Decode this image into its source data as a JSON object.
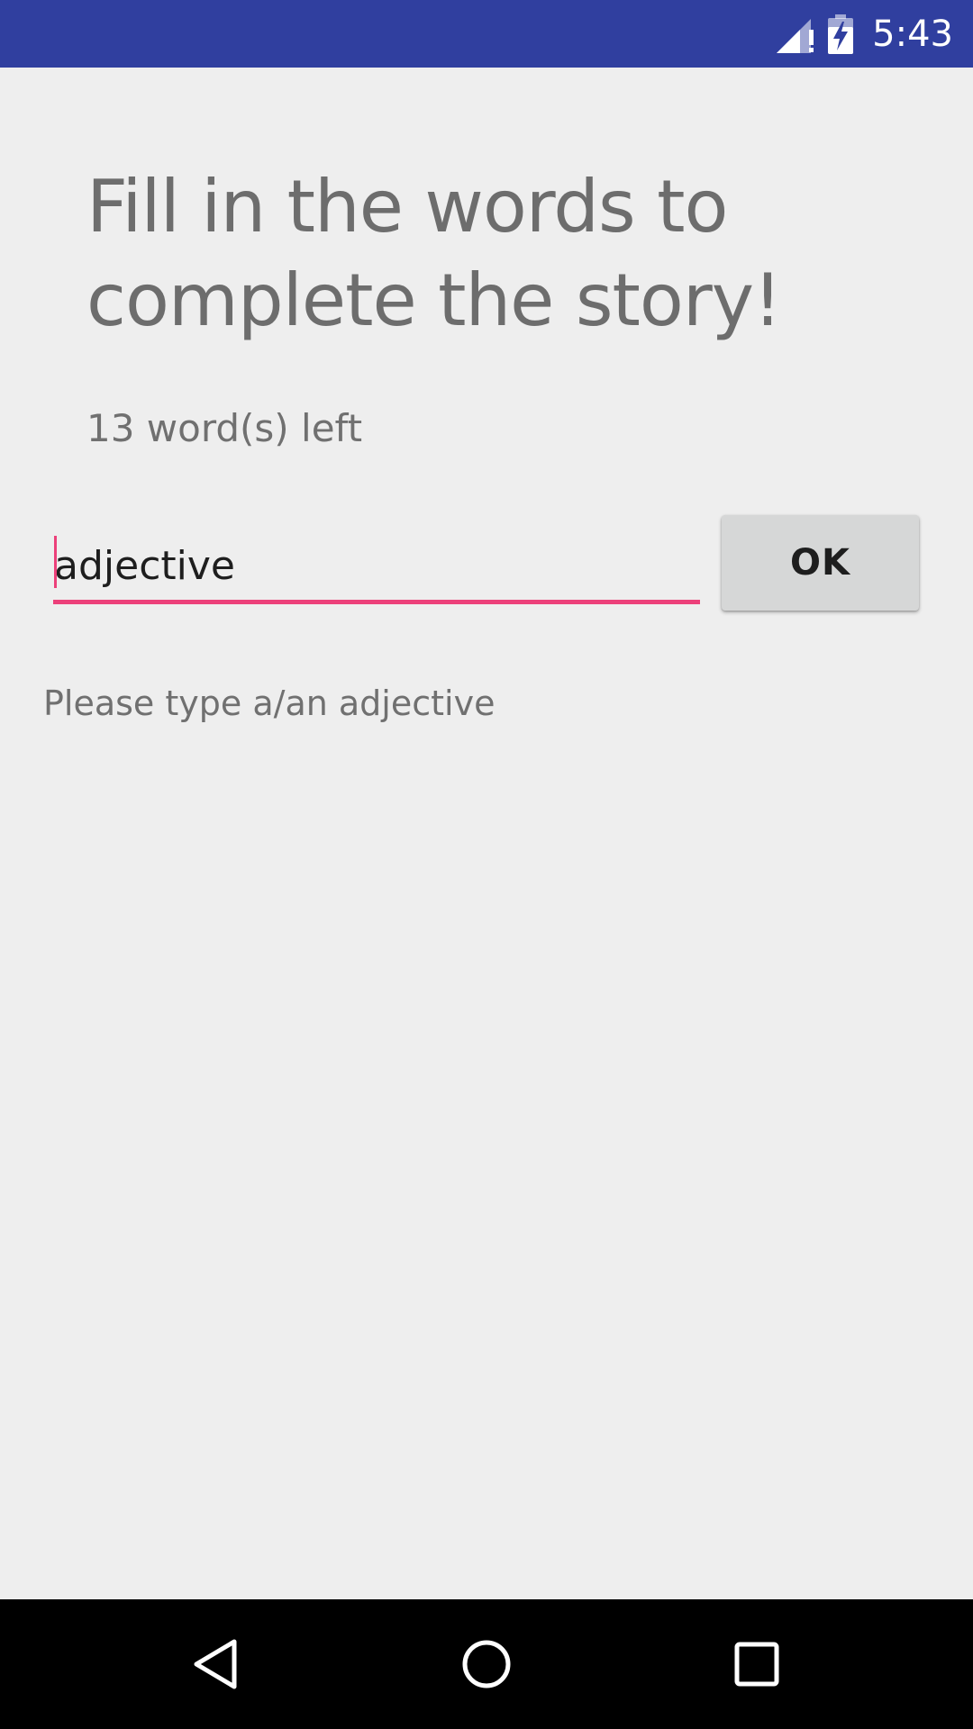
{
  "status_bar": {
    "time": "5:43",
    "background_color": "#303f9f",
    "icons": [
      "signal-alert-icon",
      "battery-charging-icon"
    ]
  },
  "main": {
    "title": "Fill in the words to complete the story!",
    "words_left": "13 word(s) left",
    "input": {
      "value": "adjective",
      "accent_color": "#ec407a"
    },
    "ok_label": "OK",
    "hint": "Please type a/an adjective"
  },
  "nav_bar": {
    "icons": [
      "back-icon",
      "home-icon",
      "recents-icon"
    ]
  }
}
